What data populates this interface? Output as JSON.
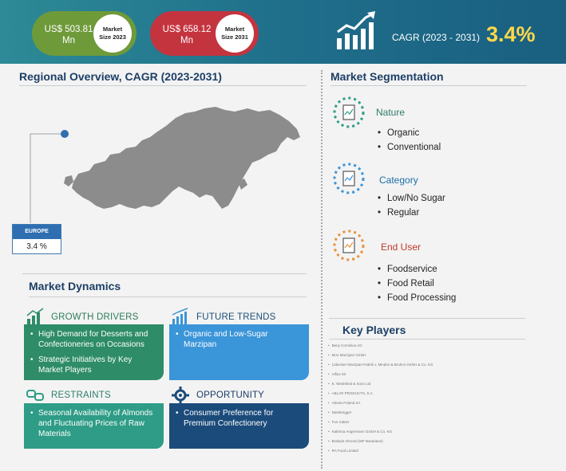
{
  "header": {
    "market_2023": {
      "amount": "US$ 503.81 Mn",
      "label": "Market Size 2023"
    },
    "market_2031": {
      "amount": "US$ 658.12 Mn",
      "label": "Market Size 2031"
    },
    "cagr_label": "CAGR (2023 - 2031)",
    "cagr_value": "3.4%"
  },
  "regional": {
    "title": "Regional Overview, CAGR (2023-2031)",
    "region": "EUROPE",
    "region_cagr": "3.4 %"
  },
  "dynamics": {
    "title": "Market Dynamics",
    "growth_drivers": {
      "heading": "GROWTH DRIVERS",
      "items": [
        "High Demand for Desserts and Confectioneries on Occasions",
        "Strategic Initiatives by Key Market Players"
      ]
    },
    "future_trends": {
      "heading": "FUTURE TRENDS",
      "items": [
        "Organic and Low-Sugar Marzipan"
      ]
    },
    "restraints": {
      "heading": "RESTRAINTS",
      "items": [
        "Seasonal Availability of Almonds and Fluctuating Prices of Raw Materials"
      ]
    },
    "opportunity": {
      "heading": "OPPORTUNITY",
      "items": [
        "Consumer Preference for Premium Confectionery"
      ]
    }
  },
  "segmentation": {
    "title": "Market Segmentation",
    "groups": [
      {
        "label": "Nature",
        "items": [
          "Organic",
          "Conventional"
        ]
      },
      {
        "label": "Category",
        "items": [
          "Low/No Sugar",
          "Regular"
        ]
      },
      {
        "label": "End User",
        "items": [
          "Foodservice",
          "Food Retail",
          "Food Processing"
        ]
      }
    ]
  },
  "key_players": {
    "title": "Key Players",
    "items": [
      "Beny Cornelius AG",
      "Mon Marzipan GmbH",
      "Lübecker Marzipan-Fabrik v. Minden & Bruhns GmbH & Co. KG",
      "Alfius Srl",
      "E. Wedekind & Sons Ltd",
      "ABLAR PRODUCTS, S.A.",
      "Aberta Poland SA",
      "Niederegger",
      "Fun Cakes",
      "Kathrina Angermann GmbH & Co. KG",
      "Brabant Almond (MF Bavarians)",
      "RA Food Limited"
    ]
  },
  "colors": {
    "header_teal": "#2d8a96",
    "pill_green": "#6f9a3a",
    "pill_red": "#c4343f",
    "cagr_yellow": "#ffd84a",
    "growth_green": "#2e8c68",
    "trends_blue": "#3b95d9",
    "restraints_teal": "#2e9c86",
    "opportunity_navy": "#1b4b7a"
  }
}
